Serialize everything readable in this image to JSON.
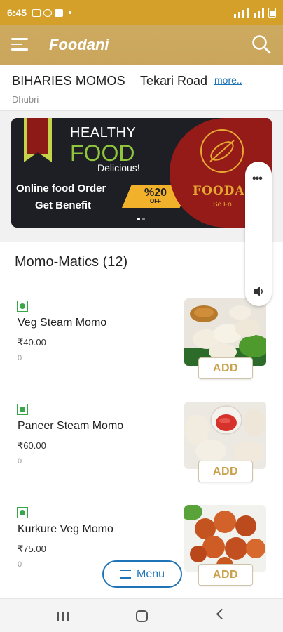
{
  "status_bar": {
    "time": "6:45"
  },
  "app_bar": {
    "title": "Foodani"
  },
  "restaurant": {
    "name": "BIHARIES MOMOS",
    "address": "Tekari Road",
    "more_label": "more..",
    "city": "Dhubri"
  },
  "banner": {
    "healthy": "HEALTHY",
    "food": "FOOD",
    "delicious": "Delicious!",
    "line1": "Online food Order",
    "line2": "Get Benefit",
    "offer": "%20",
    "offer_sub": "OFF",
    "logo_text": "FOODA",
    "logo_sub": "Se Fo"
  },
  "section": {
    "title": "Momo-Matics (12)"
  },
  "items": [
    {
      "name": "Veg Steam Momo",
      "price": "₹40.00",
      "count": "0",
      "add_label": "ADD"
    },
    {
      "name": "Paneer Steam Momo",
      "price": "₹60.00",
      "count": "0",
      "add_label": "ADD"
    },
    {
      "name": "Kurkure Veg Momo",
      "price": "₹75.00",
      "count": "0",
      "add_label": "ADD"
    }
  ],
  "menu_button": {
    "label": "Menu"
  },
  "colors": {
    "status_bar": "#d4a02a",
    "app_bar": "#c9a65c",
    "accent_blue": "#1f73b7",
    "veg_green": "#3aa64a",
    "add_text": "#c8a14a"
  },
  "icons": [
    "menu-icon",
    "search-icon",
    "more-vert-icon",
    "volume-icon",
    "veg-icon",
    "recent-apps-icon",
    "home-icon",
    "back-icon"
  ]
}
